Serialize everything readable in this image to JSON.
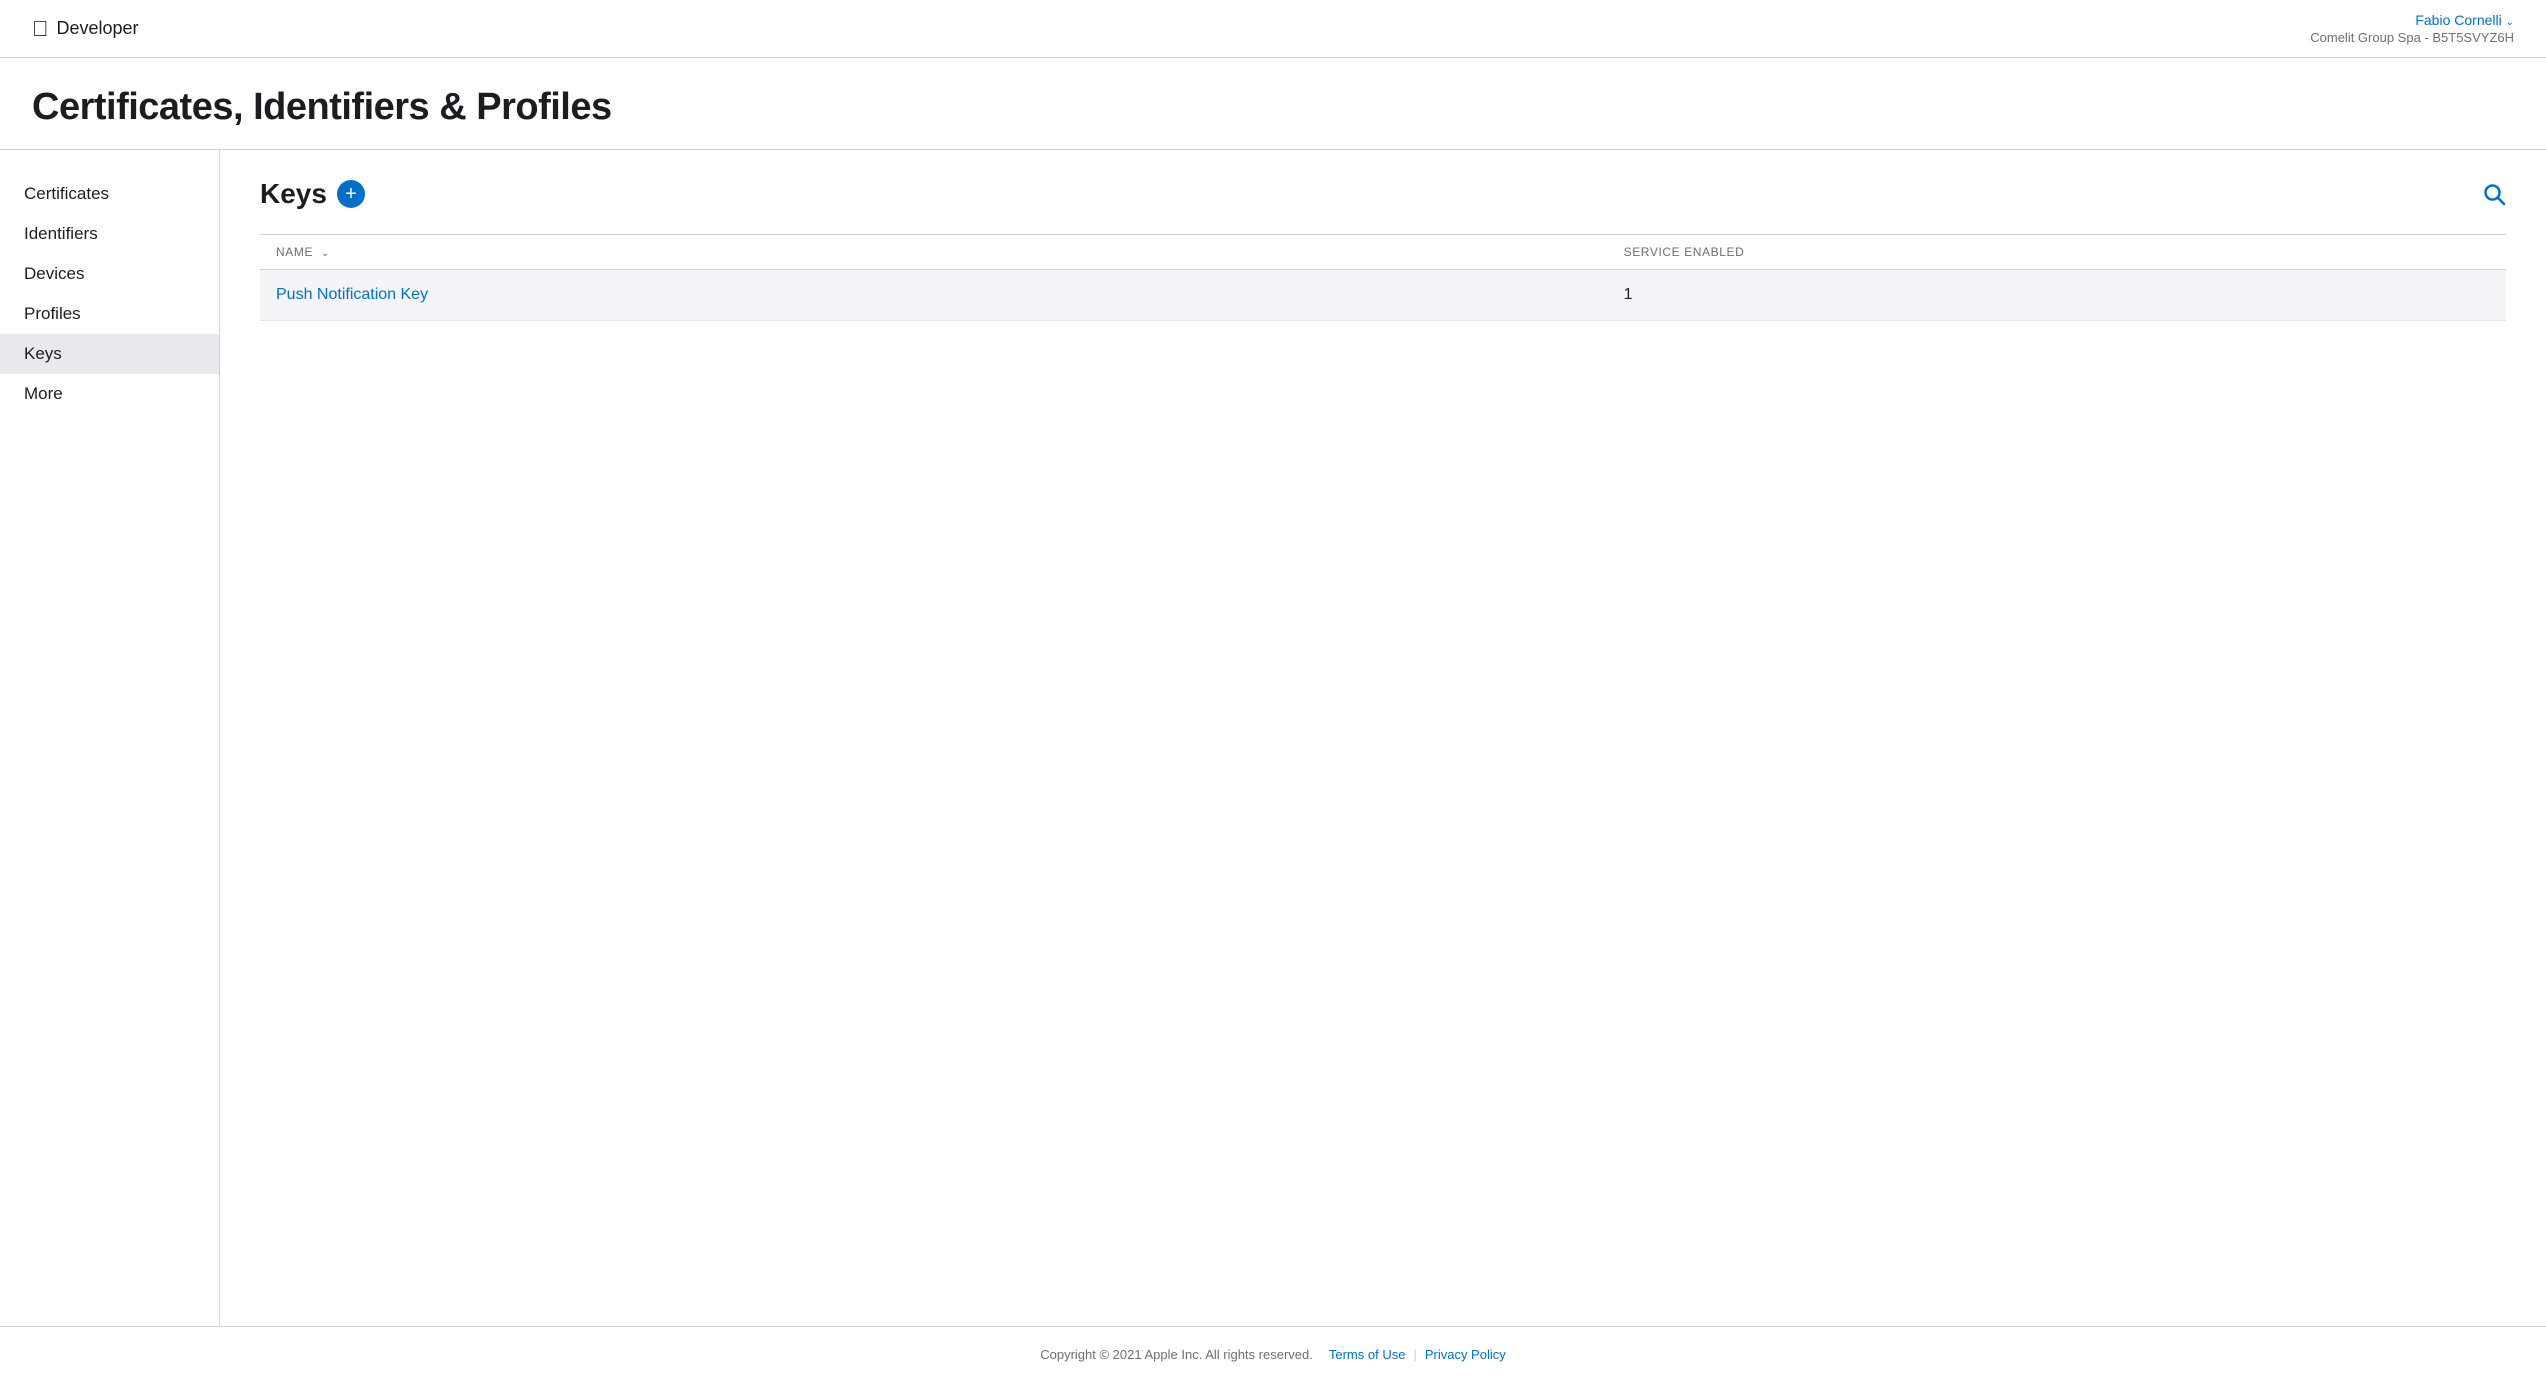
{
  "header": {
    "apple_logo": "",
    "developer_label": "Developer",
    "user_name": "Fabio Cornelli",
    "user_chevron": "›",
    "org_label": "Comelit Group Spa - B5T5SVYZ6H"
  },
  "page": {
    "title": "Certificates, Identifiers & Profiles"
  },
  "sidebar": {
    "items": [
      {
        "id": "certificates",
        "label": "Certificates",
        "active": false
      },
      {
        "id": "identifiers",
        "label": "Identifiers",
        "active": false
      },
      {
        "id": "devices",
        "label": "Devices",
        "active": false
      },
      {
        "id": "profiles",
        "label": "Profiles",
        "active": false
      },
      {
        "id": "keys",
        "label": "Keys",
        "active": true
      },
      {
        "id": "more",
        "label": "More",
        "active": false
      }
    ]
  },
  "main": {
    "section_title": "Keys",
    "add_button_label": "+",
    "table": {
      "columns": [
        {
          "id": "name",
          "label": "NAME",
          "sortable": true
        },
        {
          "id": "service",
          "label": "SERVICE ENABLED",
          "sortable": false
        }
      ],
      "rows": [
        {
          "name": "Push Notification Key",
          "service_enabled": "1"
        }
      ]
    }
  },
  "footer": {
    "copyright": "Copyright © 2021 Apple Inc. All rights reserved.",
    "links": [
      {
        "id": "terms",
        "label": "Terms of Use"
      },
      {
        "id": "privacy",
        "label": "Privacy Policy"
      }
    ]
  }
}
